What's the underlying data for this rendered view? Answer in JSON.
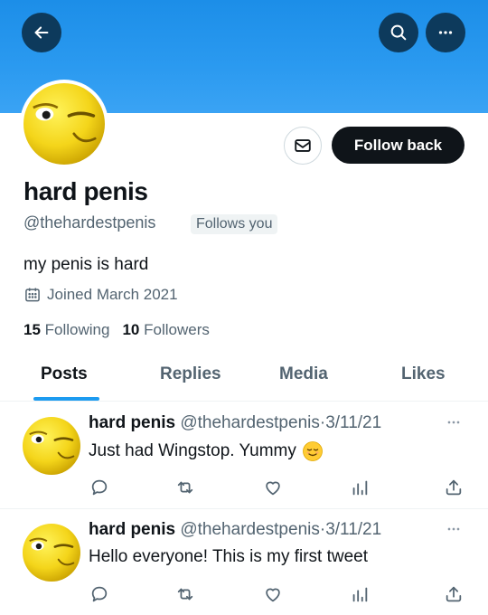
{
  "header": {
    "back_icon": "arrow-left-icon",
    "search_icon": "search-icon",
    "more_icon": "more-horizontal-icon",
    "banner_color": "#1d9bf0"
  },
  "profile": {
    "display_name": "hard penis",
    "handle": "@thehardestpenis",
    "follows_you": "Follows you",
    "bio": "my penis is hard",
    "joined": "Joined March 2021",
    "following_count": "15",
    "following_label": "Following",
    "followers_count": "10",
    "followers_label": "Followers",
    "message_icon": "mail-icon",
    "follow_button": "Follow back"
  },
  "tabs": [
    {
      "label": "Posts",
      "active": true
    },
    {
      "label": "Replies",
      "active": false
    },
    {
      "label": "Media",
      "active": false
    },
    {
      "label": "Likes",
      "active": false
    }
  ],
  "tweets": [
    {
      "name": "hard penis",
      "handle": "@thehardestpenis",
      "dot": "·",
      "date": "3/11/21",
      "text": "Just had Wingstop. Yummy",
      "emoji": "relieved-face-emoji"
    },
    {
      "name": "hard penis",
      "handle": "@thehardestpenis",
      "dot": "·",
      "date": "3/11/21",
      "text": "Hello everyone! This is my first tweet"
    }
  ],
  "colors": {
    "accent": "#1d9bf0",
    "text": "#0f1419",
    "secondary": "#536471",
    "button_dark": "#0f1419"
  }
}
